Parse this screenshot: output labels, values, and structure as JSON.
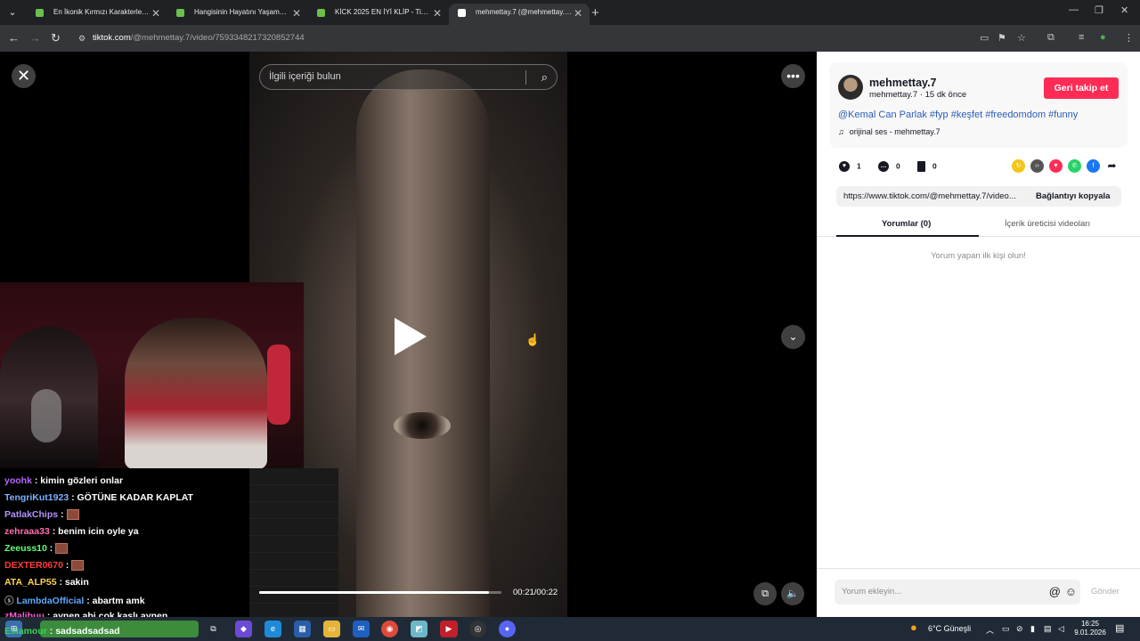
{
  "browser": {
    "tabs": [
      {
        "title": "En İkonik Kırmızı Karakterler - T",
        "color": "#6cc04a",
        "active": false
      },
      {
        "title": "Hangisinin Hayatını Yaşamak İst",
        "color": "#6cc04a",
        "active": false
      },
      {
        "title": "KİCK 2025 EN İYİ KLİP - Tier List",
        "color": "#6cc04a",
        "active": false
      },
      {
        "title": "mehmettay.7 (@mehmettay.7) |",
        "color": "#000000",
        "active": true
      }
    ],
    "url_host": "tiktok.com",
    "url_path": "/@mehmettay.7/video/7593348217320852744"
  },
  "video": {
    "search_placeholder": "İlgili içeriği bulun",
    "time": "00:21/00:22",
    "progress": 0.95
  },
  "overlay_chat": [
    {
      "user": "yoohk",
      "color": "#b667ff",
      "text": ": kimin gözleri onlar",
      "emote": false
    },
    {
      "user": "TengriKut1923",
      "color": "#7fb2ff",
      "text": ": GÖTÜNE KADAR KAPLAT",
      "emote": false
    },
    {
      "user": "PatlakChips",
      "color": "#b592ff",
      "text": " :",
      "emote": true
    },
    {
      "user": "zehraaa33",
      "color": "#ff6fae",
      "text": ": benim icin oyle ya",
      "emote": false
    },
    {
      "user": "Zeeuss10",
      "color": "#61ff7a",
      "text": " :",
      "emote": true
    },
    {
      "user": "DEXTER0670",
      "color": "#ff3b3b",
      "text": " :",
      "emote": true
    },
    {
      "user": "ATA_ALP55",
      "color": "#ffd34d",
      "text": ": sakin",
      "emote": false
    },
    {
      "user": "LambdaOfficial",
      "color": "#5fa8ff",
      "text": ": abartm amk",
      "emote": false
    },
    {
      "user": "zMalibuu",
      "color": "#ff5ed7",
      "text": ": aynen abi cok kaslı aynen",
      "emote": false
    }
  ],
  "overlay_last": {
    "user": "Eclamour",
    "text": ": sadsadsadsad"
  },
  "panel": {
    "username": "mehmettay.7",
    "subline": "mehmettay.7 · 15 dk önce",
    "follow_label": "Geri takip et",
    "caption": "@Kemal Can Parlak #fyp #keşfet #freedomdom #funny",
    "sound": "orijinal ses - mehmettay.7",
    "likes": "1",
    "comments": "0",
    "saves": "0",
    "link": "https://www.tiktok.com/@mehmettay.7/video...",
    "copy_label": "Bağlantıyı kopyala",
    "tab_comments": "Yorumlar (0)",
    "tab_creator": "İçerik üreticisi videoları",
    "empty_text": "Yorum yapan ilk kişi olun!",
    "comment_placeholder": "Yorum ekleyin...",
    "send_label": "Gönder"
  },
  "taskbar": {
    "weather": "6°C  Güneşli",
    "time": "16:25",
    "date": "9.01.2026"
  }
}
